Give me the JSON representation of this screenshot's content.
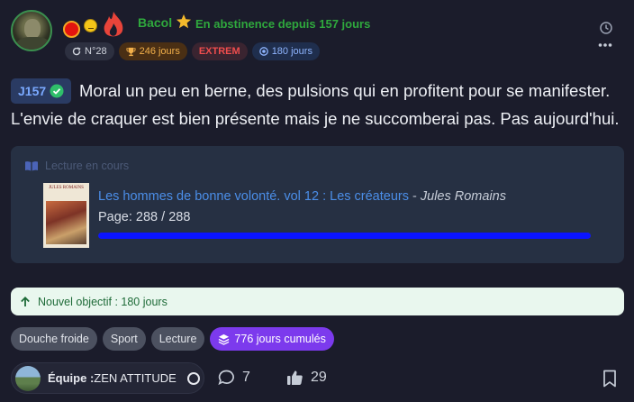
{
  "user": {
    "name": "Bacol",
    "status": "En abstinence depuis 157 jours"
  },
  "badges": {
    "rank": "N°28",
    "days": "246 jours",
    "level": "EXTREM",
    "goal": "180 jours"
  },
  "post": {
    "day_tag": "J157",
    "line1": "Moral un peu en berne, des pulsions qui en profitent pour se manifester.",
    "line2": "L'envie de craquer est bien présente mais je ne succomberai pas. Pas aujourd'hui."
  },
  "reading": {
    "header": "Lecture en cours",
    "book_title": "Les hommes de bonne volonté. vol 12 : Les créateurs",
    "separator": " - ",
    "author": "Jules Romains",
    "cover_title": "JULES ROMAINS",
    "page_info": "Page: 288 / 288",
    "progress": 1.0
  },
  "goal_banner": "Nouvel objectif : 180 jours",
  "tags": [
    "Douche froide",
    "Sport",
    "Lecture"
  ],
  "cumul_tag": "776 jours cumulés",
  "team": {
    "prefix": "Équipe :",
    "name": "ZEN ATTITUDE"
  },
  "reactions": {
    "comments": "7",
    "likes": "29"
  },
  "colors": {
    "accent_green": "#2fa83d",
    "level_red": "#ef4d4d",
    "progress_blue": "#0b14ff",
    "cumul_purple": "#7c3aed"
  }
}
